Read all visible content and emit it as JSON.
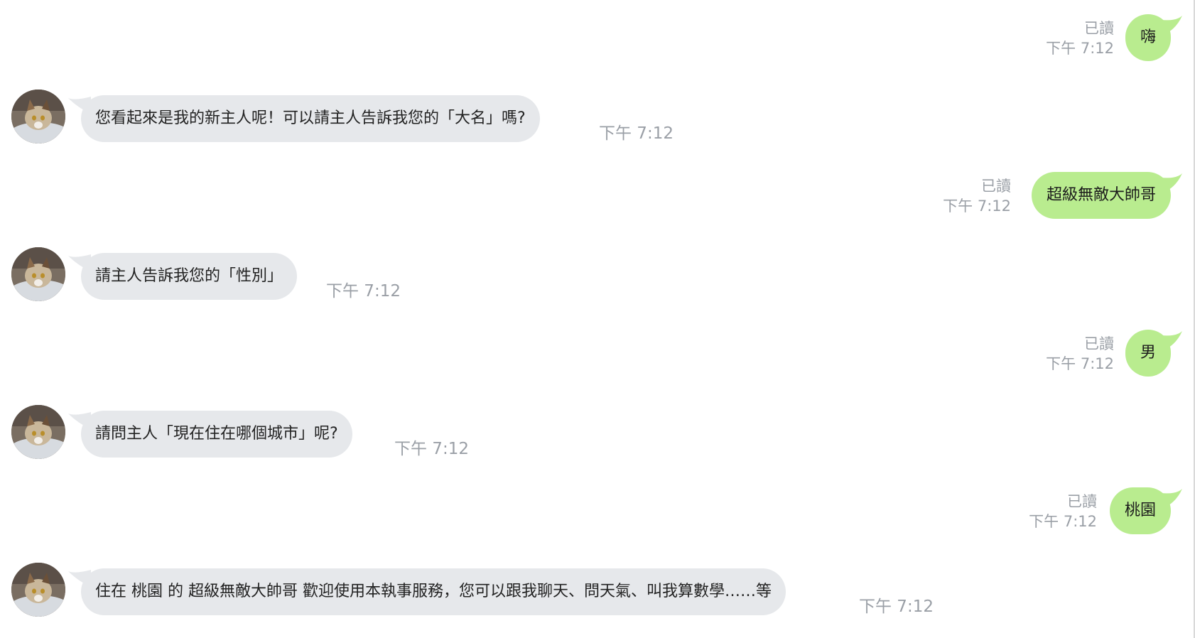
{
  "messages": [
    {
      "direction": "out",
      "text": "嗨",
      "read": "已讀",
      "time": "下午 7:12"
    },
    {
      "direction": "in",
      "text": "您看起來是我的新主人呢！可以請主人告訴我您的「大名」嗎?",
      "time": "下午 7:12",
      "avatar": "cat-avatar"
    },
    {
      "direction": "out",
      "text": "超級無敵大帥哥",
      "read": "已讀",
      "time": "下午 7:12"
    },
    {
      "direction": "in",
      "text": "請主人告訴我您的「性別」",
      "time": "下午 7:12",
      "avatar": "cat-avatar"
    },
    {
      "direction": "out",
      "text": "男",
      "read": "已讀",
      "time": "下午 7:12"
    },
    {
      "direction": "in",
      "text": "請問主人「現在住在哪個城市」呢?",
      "time": "下午 7:12",
      "avatar": "cat-avatar"
    },
    {
      "direction": "out",
      "text": "桃園",
      "read": "已讀",
      "time": "下午 7:12"
    },
    {
      "direction": "in",
      "text": "住在 桃園 的 超級無敵大帥哥 歡迎使用本執事服務，您可以跟我聊天、問天氣、叫我算數學……等",
      "time": "下午 7:12",
      "avatar": "cat-avatar"
    }
  ],
  "colors": {
    "outgoing_bubble": "#b9ec8f",
    "incoming_bubble": "#e6e8eb",
    "meta_text": "#9a9fa6"
  }
}
